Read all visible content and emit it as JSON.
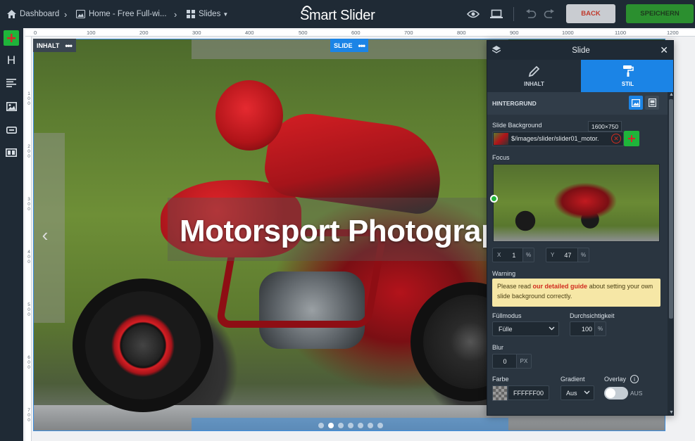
{
  "topbar": {
    "breadcrumbs": [
      {
        "label": "Dashboard",
        "icon": "home-icon"
      },
      {
        "label": "Home - Free Full-wi...",
        "icon": "image-icon"
      },
      {
        "label": "Slides",
        "icon": "grid-icon"
      }
    ],
    "logo": "Smart Slider",
    "back_label": "BACK",
    "save_label": "SPEICHERN"
  },
  "ruler": {
    "top_ticks": [
      "0",
      "100",
      "200",
      "300",
      "400",
      "500",
      "600",
      "700",
      "800",
      "900",
      "1000",
      "1100",
      "1200"
    ],
    "left_ticks": [
      "1\n0\n0",
      "2\n0\n0",
      "3\n0\n0",
      "4\n0\n0",
      "5\n0\n0",
      "6\n0\n0",
      "7\n0\n0"
    ]
  },
  "canvas": {
    "inhalt_tag": "INHALT",
    "slide_tag": "SLIDE",
    "title": "Motorsport Photograp",
    "dots_count": 7,
    "active_dot": 1
  },
  "panel": {
    "title": "Slide",
    "tabs": [
      {
        "label": "INHALT",
        "icon": "pen-icon",
        "active": false
      },
      {
        "label": "STIL",
        "icon": "paint-roller-icon",
        "active": true
      }
    ],
    "section": "HINTERGRUND",
    "slide_background_label": "Slide Background",
    "image_size": "1600×750",
    "image_path": "$/images/slider/slider01_motor.",
    "focus_label": "Focus",
    "focus_x_label": "X",
    "focus_x": "1",
    "focus_y_label": "Y",
    "focus_y": "47",
    "percent": "%",
    "warning_label": "Warning",
    "warning_pre": "Please read ",
    "warning_link": "our detailed guide",
    "warning_post": " about setting your own slide background correctly.",
    "fill_mode_label": "Füllmodus",
    "fill_mode_value": "Fülle",
    "opacity_label": "Durchsichtigkeit",
    "opacity_value": "100",
    "blur_label": "Blur",
    "blur_value": "0",
    "blur_unit": "PX",
    "color_label": "Farbe",
    "color_value": "FFFFFF00",
    "gradient_label": "Gradient",
    "gradient_value": "Aus",
    "overlay_label": "Overlay",
    "overlay_state": "AUS"
  },
  "colors": {
    "accent": "#1b84e6",
    "save": "#2b8f2f",
    "add_green": "#1fb53a",
    "topbar": "#1f2a35",
    "warning": "#f6e7a6"
  }
}
